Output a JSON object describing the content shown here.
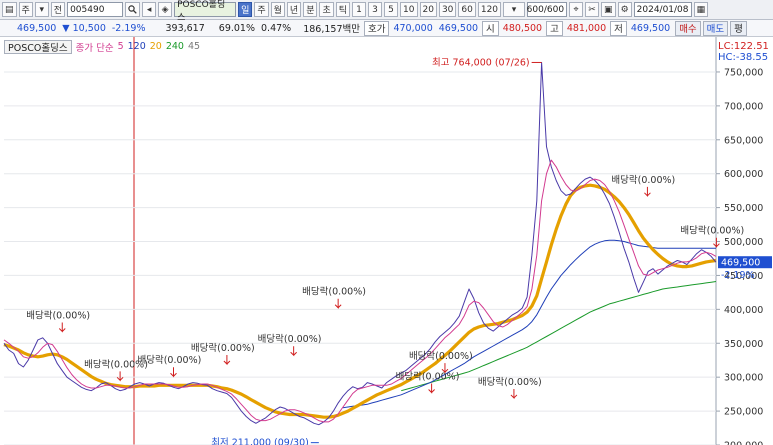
{
  "toolbar": {
    "items": [
      "▤",
      "주",
      "▾",
      "전"
    ],
    "code": "005490",
    "search_icon": "magnifier-icon",
    "items2": [
      "◂",
      "◈"
    ],
    "name_badge": "POSCO홀딩스",
    "periods": [
      "일",
      "주",
      "월",
      "년",
      "분",
      "초",
      "틱",
      "1",
      "3",
      "5",
      "10",
      "20",
      "30",
      "60",
      "120"
    ],
    "count": "600",
    "count_total": "/600",
    "date": "2024/01/08"
  },
  "quote": {
    "price": "469,500",
    "change": "▼ 10,500",
    "rate": "-2.19%",
    "volume": "393,617",
    "ratio": "69.01%",
    "turnover": "0.47%",
    "amount": "186,157백만",
    "ask_label": "호가",
    "ask1": "470,000",
    "ask2": "469,500",
    "open_label": "시",
    "open": "480,500",
    "high_label": "고",
    "high": "481,000",
    "low_label": "저",
    "low": "469,500",
    "buy": "매수",
    "sell": "매도",
    "eval": "평"
  },
  "legend": {
    "name": "POSCO홀딩스",
    "label": "종가 단순",
    "ma": [
      "5",
      "120",
      "20",
      "240",
      "45"
    ],
    "ma_colors": [
      "#d23a8f",
      "#1f3fb8",
      "#e5a000",
      "#1a9a2a",
      "#7a7a7a"
    ]
  },
  "chart_data": {
    "type": "line",
    "y_ticks": [
      "750,000",
      "700,000",
      "650,000",
      "600,000",
      "550,000",
      "500,000",
      "450,000",
      "400,000",
      "350,000",
      "300,000",
      "250,000",
      "200,000"
    ],
    "ylim": [
      200000,
      775000
    ],
    "lc": "LC:122.51",
    "hc": "HC:-38.55",
    "current_price": "469,500",
    "current_rate": "-2.19%",
    "annotations": {
      "max": "최고 764,000 (07/26)",
      "min": "최저 211,000 (09/30)",
      "dividend": "배당락(0.00%)"
    },
    "close": [
      350000,
      340000,
      335000,
      320000,
      315000,
      325000,
      340000,
      355000,
      358000,
      350000,
      335000,
      320000,
      310000,
      300000,
      295000,
      290000,
      285000,
      282000,
      280000,
      284000,
      290000,
      292000,
      288000,
      283000,
      280000,
      282000,
      286000,
      290000,
      292000,
      290000,
      287000,
      290000,
      292000,
      291000,
      288000,
      285000,
      283000,
      286000,
      290000,
      292000,
      291000,
      289000,
      288000,
      283000,
      280000,
      278000,
      276000,
      270000,
      260000,
      250000,
      242000,
      236000,
      232000,
      236000,
      240000,
      246000,
      252000,
      256000,
      254000,
      250000,
      246000,
      242000,
      240000,
      236000,
      232000,
      230000,
      234000,
      240000,
      250000,
      262000,
      272000,
      280000,
      286000,
      283000,
      285000,
      292000,
      290000,
      287000,
      284000,
      292000,
      297000,
      302000,
      306000,
      310000,
      316000,
      322000,
      328000,
      334000,
      342000,
      352000,
      360000,
      366000,
      372000,
      380000,
      390000,
      410000,
      430000,
      416000,
      395000,
      380000,
      372000,
      368000,
      374000,
      380000,
      386000,
      392000,
      396000,
      402000,
      418000,
      480000,
      560000,
      764000,
      640000,
      610000,
      590000,
      575000,
      568000,
      570000,
      578000,
      586000,
      592000,
      595000,
      590000,
      582000,
      570000,
      556000,
      536000,
      514000,
      490000,
      470000,
      446000,
      425000,
      440000,
      456000,
      460000,
      452000,
      458000,
      464000,
      468000,
      472000,
      470000,
      466000,
      474000,
      482000,
      488000,
      484000,
      478000,
      469500
    ],
    "ma5": [
      355000,
      350000,
      344000,
      338000,
      330000,
      328000,
      330000,
      336000,
      344000,
      350000,
      348000,
      338000,
      326000,
      314000,
      304000,
      296000,
      290000,
      286000,
      284000,
      284000,
      286000,
      288000,
      288000,
      287000,
      285000,
      284000,
      284000,
      286000,
      288000,
      290000,
      290000,
      290000,
      290000,
      290000,
      289000,
      287000,
      285000,
      285000,
      286000,
      288000,
      289000,
      290000,
      290000,
      288000,
      285000,
      282000,
      279000,
      275000,
      268000,
      260000,
      252000,
      244000,
      238000,
      236000,
      236000,
      238000,
      242000,
      246000,
      250000,
      252000,
      252000,
      250000,
      247000,
      244000,
      240000,
      236000,
      234000,
      234000,
      238000,
      246000,
      256000,
      266000,
      276000,
      282000,
      284000,
      286000,
      288000,
      288000,
      288000,
      288000,
      290000,
      294000,
      298000,
      304000,
      310000,
      316000,
      322000,
      328000,
      334000,
      342000,
      350000,
      358000,
      364000,
      371000,
      378000,
      390000,
      406000,
      412000,
      410000,
      402000,
      392000,
      382000,
      376000,
      374000,
      378000,
      384000,
      390000,
      396000,
      404000,
      430000,
      480000,
      560000,
      600000,
      620000,
      610000,
      596000,
      584000,
      576000,
      574000,
      578000,
      584000,
      590000,
      592000,
      590000,
      584000,
      574000,
      560000,
      544000,
      524000,
      504000,
      484000,
      464000,
      452000,
      450000,
      454000,
      458000,
      460000,
      462000,
      465000,
      468000,
      470000,
      470000,
      472000,
      476000,
      482000,
      484000,
      482000,
      478000
    ],
    "ma20": [
      348000,
      346000,
      343000,
      340000,
      336000,
      333000,
      331000,
      330000,
      331000,
      333000,
      334000,
      333000,
      330000,
      326000,
      321000,
      316000,
      311000,
      306000,
      301000,
      297000,
      294000,
      291000,
      289000,
      288000,
      287000,
      286000,
      286000,
      286000,
      287000,
      287000,
      287000,
      287000,
      288000,
      288000,
      288000,
      288000,
      288000,
      288000,
      288000,
      288000,
      288000,
      288000,
      288000,
      287000,
      286000,
      284000,
      283000,
      281000,
      278000,
      275000,
      271000,
      267000,
      263000,
      259000,
      255000,
      252000,
      249000,
      247000,
      246000,
      245000,
      245000,
      245000,
      245000,
      244000,
      243000,
      242000,
      241000,
      241000,
      242000,
      244000,
      247000,
      250000,
      254000,
      258000,
      262000,
      266000,
      270000,
      274000,
      277000,
      280000,
      283000,
      286000,
      289000,
      293000,
      297000,
      301000,
      305000,
      310000,
      315000,
      320000,
      326000,
      332000,
      338000,
      345000,
      352000,
      359000,
      366000,
      371000,
      374000,
      376000,
      377000,
      378000,
      379000,
      381000,
      383000,
      385000,
      388000,
      391000,
      396000,
      405000,
      420000,
      445000,
      470000,
      495000,
      518000,
      538000,
      555000,
      568000,
      576000,
      580000,
      582000,
      583000,
      582000,
      580000,
      577000,
      572000,
      566000,
      559000,
      550000,
      540000,
      528000,
      516000,
      505000,
      496000,
      488000,
      481000,
      475000,
      470000,
      466000,
      464000,
      463000,
      463000,
      464000,
      466000,
      468000,
      470000,
      471000,
      472000
    ],
    "ma120": [
      null,
      null,
      null,
      null,
      null,
      null,
      null,
      null,
      null,
      null,
      null,
      null,
      null,
      null,
      null,
      null,
      null,
      null,
      null,
      null,
      null,
      null,
      null,
      null,
      null,
      null,
      null,
      null,
      null,
      null,
      null,
      null,
      null,
      null,
      null,
      null,
      null,
      null,
      null,
      null,
      null,
      null,
      null,
      null,
      null,
      null,
      null,
      null,
      null,
      null,
      null,
      null,
      null,
      null,
      null,
      null,
      null,
      null,
      null,
      null,
      null,
      null,
      null,
      null,
      null,
      null,
      null,
      null,
      null,
      null,
      255000,
      256000,
      257000,
      258000,
      259000,
      260000,
      262000,
      264000,
      266000,
      268000,
      270000,
      272000,
      274000,
      277000,
      280000,
      283000,
      286000,
      289000,
      292000,
      296000,
      300000,
      304000,
      308000,
      312000,
      316000,
      320000,
      325000,
      330000,
      334000,
      338000,
      342000,
      346000,
      350000,
      354000,
      358000,
      362000,
      366000,
      370000,
      375000,
      382000,
      392000,
      405000,
      418000,
      430000,
      440000,
      450000,
      458000,
      466000,
      473000,
      480000,
      486000,
      492000,
      496000,
      499000,
      501000,
      502000,
      502000,
      501000,
      500000,
      498000,
      496000,
      494000,
      493000,
      492000,
      491000,
      490000,
      490000,
      490000,
      490000,
      490000,
      490000,
      490000,
      490000,
      490000,
      490000,
      490000,
      490000,
      490000
    ],
    "ma240": [
      null,
      null,
      null,
      null,
      null,
      null,
      null,
      null,
      null,
      null,
      null,
      null,
      null,
      null,
      null,
      null,
      null,
      null,
      null,
      null,
      null,
      null,
      null,
      null,
      null,
      null,
      null,
      null,
      null,
      null,
      null,
      null,
      null,
      null,
      null,
      null,
      null,
      null,
      null,
      null,
      null,
      null,
      null,
      null,
      null,
      null,
      null,
      null,
      null,
      null,
      null,
      null,
      null,
      null,
      null,
      null,
      null,
      null,
      null,
      null,
      null,
      null,
      null,
      null,
      null,
      null,
      null,
      null,
      null,
      null,
      null,
      null,
      null,
      null,
      null,
      null,
      null,
      null,
      null,
      null,
      null,
      null,
      280000,
      282000,
      284000,
      286000,
      288000,
      290000,
      292000,
      294000,
      296000,
      298000,
      300000,
      302000,
      304000,
      306000,
      308000,
      311000,
      314000,
      317000,
      320000,
      323000,
      326000,
      329000,
      332000,
      335000,
      338000,
      341000,
      344000,
      348000,
      352000,
      356000,
      360000,
      364000,
      368000,
      372000,
      376000,
      380000,
      384000,
      388000,
      392000,
      396000,
      399000,
      402000,
      405000,
      408000,
      410000,
      412000,
      414000,
      416000,
      418000,
      420000,
      422000,
      424000,
      426000,
      428000,
      430000,
      431000,
      432000,
      433000,
      434000,
      435000,
      436000,
      437000,
      438000,
      439000,
      440000,
      441000
    ]
  }
}
